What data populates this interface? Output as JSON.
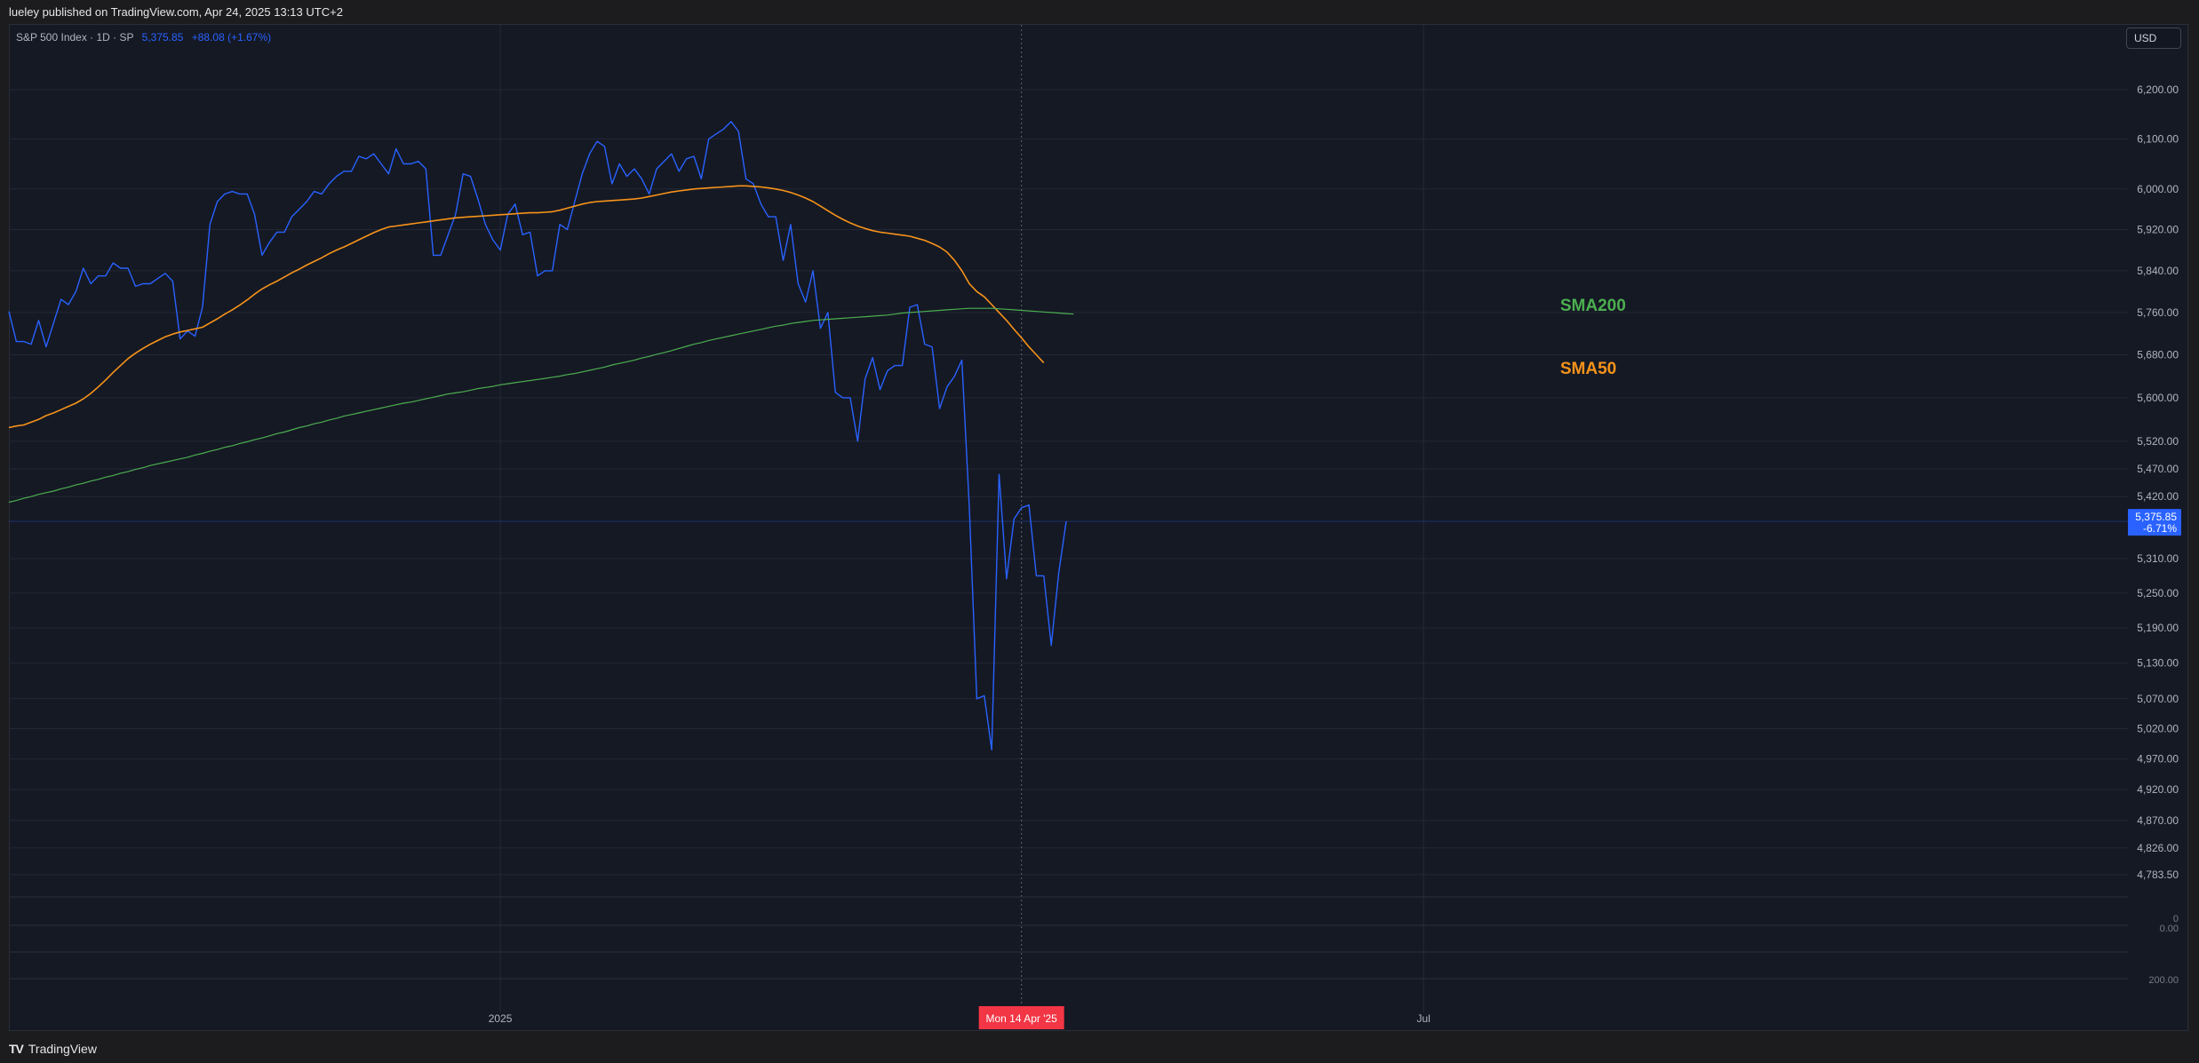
{
  "header": {
    "published_text": "lueley published on TradingView.com, Apr 24, 2025 13:13 UTC+2"
  },
  "legend": {
    "symbol": "S&P 500 Index · 1D · SP",
    "price": "5,375.85",
    "change": "+88.08 (+1.67%)"
  },
  "currency_button": "USD",
  "footer": {
    "logo_mark": "TV",
    "brand": "TradingView"
  },
  "colors": {
    "price_line": "#2962ff",
    "sma50": "#f7931a",
    "sma200": "#4caf50",
    "crosshair_label": "#f23645",
    "price_label": "#2962ff"
  },
  "chart_data": {
    "type": "line",
    "title": "S&P 500 Index",
    "xlabel": "",
    "ylabel": "",
    "ylim": [
      4783.5,
      6240
    ],
    "y_scale": "log",
    "grid": true,
    "x_tick_labels": [
      "2025",
      "Jul"
    ],
    "x_ticks": [
      {
        "label": "2025",
        "at_index": 66
      },
      {
        "label": "Jul",
        "at_index": 190
      }
    ],
    "crosshair": {
      "label": "Mon 14 Apr '25",
      "at_index": 136
    },
    "y_tick_labels": [
      "6,200.00",
      "6,100.00",
      "6,000.00",
      "5,920.00",
      "5,840.00",
      "5,760.00",
      "5,680.00",
      "5,600.00",
      "5,520.00",
      "5,470.00",
      "5,420.00",
      "5,310.00",
      "5,250.00",
      "5,190.00",
      "5,130.00",
      "5,070.00",
      "5,020.00",
      "4,970.00",
      "4,920.00",
      "4,870.00",
      "4,826.00",
      "4,783.50"
    ],
    "y_ticks": [
      6200,
      6100,
      6000,
      5920,
      5840,
      5760,
      5680,
      5600,
      5520,
      5470,
      5420,
      5310,
      5250,
      5190,
      5130,
      5070,
      5020,
      4970,
      4920,
      4870,
      4826,
      4783.5
    ],
    "last_value_label": {
      "value": "5,375.85",
      "change": "-6.71%"
    },
    "lower_pane_labels": [
      "0",
      "0.00",
      "200.00"
    ],
    "series": [
      {
        "name": "S&P 500",
        "values": [
          5762,
          5705,
          5705,
          5700,
          5745,
          5695,
          5740,
          5785,
          5775,
          5800,
          5845,
          5815,
          5830,
          5830,
          5855,
          5845,
          5845,
          5810,
          5815,
          5815,
          5825,
          5835,
          5820,
          5710,
          5725,
          5715,
          5770,
          5930,
          5975,
          5990,
          5995,
          5990,
          5990,
          5950,
          5870,
          5895,
          5915,
          5915,
          5945,
          5960,
          5975,
          5995,
          5990,
          6010,
          6025,
          6035,
          6035,
          6065,
          6060,
          6070,
          6050,
          6030,
          6080,
          6050,
          6050,
          6055,
          6040,
          5870,
          5870,
          5910,
          5950,
          6030,
          6025,
          5980,
          5930,
          5900,
          5880,
          5950,
          5970,
          5910,
          5915,
          5830,
          5840,
          5840,
          5930,
          5920,
          5975,
          6030,
          6070,
          6095,
          6085,
          6010,
          6050,
          6025,
          6040,
          6020,
          5990,
          6040,
          6055,
          6070,
          6035,
          6060,
          6065,
          6020,
          6100,
          6110,
          6120,
          6135,
          6115,
          6020,
          6010,
          5970,
          5945,
          5945,
          5860,
          5930,
          5815,
          5780,
          5840,
          5730,
          5760,
          5610,
          5600,
          5600,
          5520,
          5635,
          5675,
          5615,
          5650,
          5660,
          5660,
          5770,
          5775,
          5700,
          5695,
          5580,
          5620,
          5640,
          5670,
          5400,
          5070,
          5075,
          4985,
          5460,
          5275,
          5380,
          5400,
          5405,
          5280,
          5280,
          5160,
          5285,
          5375.85
        ]
      },
      {
        "name": "SMA50",
        "values": [
          5545,
          5548,
          5550,
          5555,
          5560,
          5567,
          5572,
          5578,
          5584,
          5590,
          5598,
          5608,
          5620,
          5633,
          5647,
          5660,
          5673,
          5683,
          5692,
          5700,
          5707,
          5714,
          5719,
          5723,
          5726,
          5729,
          5732,
          5740,
          5748,
          5757,
          5765,
          5774,
          5784,
          5795,
          5805,
          5813,
          5820,
          5828,
          5836,
          5843,
          5851,
          5858,
          5865,
          5873,
          5880,
          5886,
          5893,
          5900,
          5907,
          5914,
          5920,
          5925,
          5927,
          5929,
          5931,
          5933,
          5935,
          5937,
          5939,
          5941,
          5943,
          5944,
          5945,
          5946,
          5947,
          5948,
          5949,
          5950,
          5951,
          5952,
          5953,
          5953,
          5954,
          5955,
          5958,
          5962,
          5966,
          5970,
          5973,
          5975,
          5976,
          5977,
          5978,
          5979,
          5980,
          5982,
          5985,
          5988,
          5991,
          5994,
          5996,
          5998,
          6000,
          6001,
          6002,
          6003,
          6004,
          6005,
          6006,
          6006,
          6005,
          6004,
          6002,
          6000,
          5997,
          5993,
          5988,
          5982,
          5975,
          5966,
          5957,
          5948,
          5940,
          5933,
          5927,
          5922,
          5918,
          5915,
          5913,
          5911,
          5909,
          5907,
          5903,
          5899,
          5893,
          5886,
          5876,
          5860,
          5840,
          5815,
          5800,
          5790,
          5775,
          5760,
          5745,
          5728,
          5712,
          5695,
          5680,
          5665
        ]
      },
      {
        "name": "SMA200",
        "values": [
          5410,
          5413,
          5417,
          5420,
          5424,
          5427,
          5430,
          5434,
          5437,
          5441,
          5444,
          5448,
          5451,
          5455,
          5458,
          5462,
          5465,
          5469,
          5472,
          5476,
          5479,
          5482,
          5485,
          5488,
          5491,
          5495,
          5498,
          5502,
          5505,
          5509,
          5512,
          5516,
          5519,
          5523,
          5526,
          5530,
          5534,
          5537,
          5541,
          5545,
          5548,
          5552,
          5555,
          5559,
          5562,
          5566,
          5569,
          5572,
          5575,
          5578,
          5581,
          5584,
          5587,
          5590,
          5592,
          5595,
          5598,
          5601,
          5604,
          5607,
          5609,
          5611,
          5614,
          5617,
          5619,
          5621,
          5624,
          5626,
          5628,
          5630,
          5632,
          5634,
          5636,
          5638,
          5640,
          5643,
          5645,
          5648,
          5651,
          5654,
          5657,
          5661,
          5664,
          5667,
          5670,
          5674,
          5677,
          5681,
          5684,
          5688,
          5692,
          5696,
          5700,
          5703,
          5707,
          5710,
          5713,
          5716,
          5719,
          5722,
          5725,
          5728,
          5731,
          5734,
          5736,
          5739,
          5741,
          5743,
          5745,
          5746,
          5747,
          5748,
          5749,
          5750,
          5751,
          5752,
          5753,
          5754,
          5755,
          5757,
          5759,
          5760,
          5761,
          5762,
          5763,
          5764,
          5765,
          5766,
          5767,
          5768,
          5768,
          5768,
          5768,
          5767,
          5766,
          5765,
          5764,
          5763,
          5762,
          5761,
          5760,
          5759,
          5758,
          5757
        ]
      }
    ],
    "annotations": [
      {
        "text": "SMA200",
        "color": "#4caf50"
      },
      {
        "text": "SMA50",
        "color": "#f7931a"
      }
    ]
  }
}
